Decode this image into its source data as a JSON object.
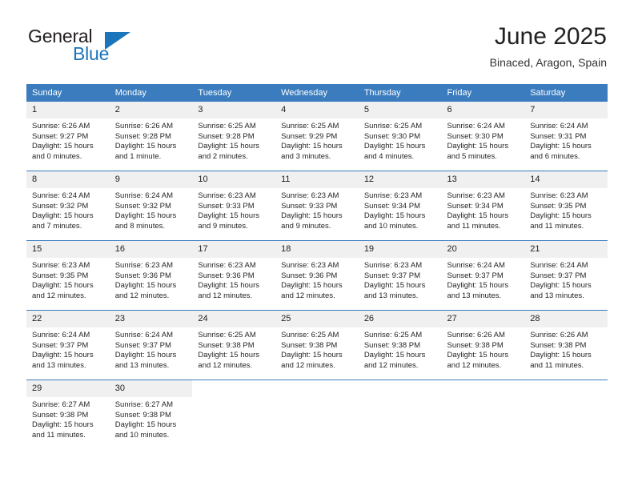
{
  "brand": {
    "name_top": "General",
    "name_bottom": "Blue",
    "triangle_color": "#1b75bb",
    "text_color": "#231f20"
  },
  "header": {
    "title": "June 2025",
    "subtitle": "Binaced, Aragon, Spain"
  },
  "theme": {
    "header_bar": "#3a7cbe",
    "daynum_bg": "#f0f0f0",
    "text": "#262626"
  },
  "weekday_headers": [
    "Sunday",
    "Monday",
    "Tuesday",
    "Wednesday",
    "Thursday",
    "Friday",
    "Saturday"
  ],
  "weeks": [
    [
      {
        "day": "1",
        "sunrise": "Sunrise: 6:26 AM",
        "sunset": "Sunset: 9:27 PM",
        "daylight_1": "Daylight: 15 hours",
        "daylight_2": "and 0 minutes."
      },
      {
        "day": "2",
        "sunrise": "Sunrise: 6:26 AM",
        "sunset": "Sunset: 9:28 PM",
        "daylight_1": "Daylight: 15 hours",
        "daylight_2": "and 1 minute."
      },
      {
        "day": "3",
        "sunrise": "Sunrise: 6:25 AM",
        "sunset": "Sunset: 9:28 PM",
        "daylight_1": "Daylight: 15 hours",
        "daylight_2": "and 2 minutes."
      },
      {
        "day": "4",
        "sunrise": "Sunrise: 6:25 AM",
        "sunset": "Sunset: 9:29 PM",
        "daylight_1": "Daylight: 15 hours",
        "daylight_2": "and 3 minutes."
      },
      {
        "day": "5",
        "sunrise": "Sunrise: 6:25 AM",
        "sunset": "Sunset: 9:30 PM",
        "daylight_1": "Daylight: 15 hours",
        "daylight_2": "and 4 minutes."
      },
      {
        "day": "6",
        "sunrise": "Sunrise: 6:24 AM",
        "sunset": "Sunset: 9:30 PM",
        "daylight_1": "Daylight: 15 hours",
        "daylight_2": "and 5 minutes."
      },
      {
        "day": "7",
        "sunrise": "Sunrise: 6:24 AM",
        "sunset": "Sunset: 9:31 PM",
        "daylight_1": "Daylight: 15 hours",
        "daylight_2": "and 6 minutes."
      }
    ],
    [
      {
        "day": "8",
        "sunrise": "Sunrise: 6:24 AM",
        "sunset": "Sunset: 9:32 PM",
        "daylight_1": "Daylight: 15 hours",
        "daylight_2": "and 7 minutes."
      },
      {
        "day": "9",
        "sunrise": "Sunrise: 6:24 AM",
        "sunset": "Sunset: 9:32 PM",
        "daylight_1": "Daylight: 15 hours",
        "daylight_2": "and 8 minutes."
      },
      {
        "day": "10",
        "sunrise": "Sunrise: 6:23 AM",
        "sunset": "Sunset: 9:33 PM",
        "daylight_1": "Daylight: 15 hours",
        "daylight_2": "and 9 minutes."
      },
      {
        "day": "11",
        "sunrise": "Sunrise: 6:23 AM",
        "sunset": "Sunset: 9:33 PM",
        "daylight_1": "Daylight: 15 hours",
        "daylight_2": "and 9 minutes."
      },
      {
        "day": "12",
        "sunrise": "Sunrise: 6:23 AM",
        "sunset": "Sunset: 9:34 PM",
        "daylight_1": "Daylight: 15 hours",
        "daylight_2": "and 10 minutes."
      },
      {
        "day": "13",
        "sunrise": "Sunrise: 6:23 AM",
        "sunset": "Sunset: 9:34 PM",
        "daylight_1": "Daylight: 15 hours",
        "daylight_2": "and 11 minutes."
      },
      {
        "day": "14",
        "sunrise": "Sunrise: 6:23 AM",
        "sunset": "Sunset: 9:35 PM",
        "daylight_1": "Daylight: 15 hours",
        "daylight_2": "and 11 minutes."
      }
    ],
    [
      {
        "day": "15",
        "sunrise": "Sunrise: 6:23 AM",
        "sunset": "Sunset: 9:35 PM",
        "daylight_1": "Daylight: 15 hours",
        "daylight_2": "and 12 minutes."
      },
      {
        "day": "16",
        "sunrise": "Sunrise: 6:23 AM",
        "sunset": "Sunset: 9:36 PM",
        "daylight_1": "Daylight: 15 hours",
        "daylight_2": "and 12 minutes."
      },
      {
        "day": "17",
        "sunrise": "Sunrise: 6:23 AM",
        "sunset": "Sunset: 9:36 PM",
        "daylight_1": "Daylight: 15 hours",
        "daylight_2": "and 12 minutes."
      },
      {
        "day": "18",
        "sunrise": "Sunrise: 6:23 AM",
        "sunset": "Sunset: 9:36 PM",
        "daylight_1": "Daylight: 15 hours",
        "daylight_2": "and 12 minutes."
      },
      {
        "day": "19",
        "sunrise": "Sunrise: 6:23 AM",
        "sunset": "Sunset: 9:37 PM",
        "daylight_1": "Daylight: 15 hours",
        "daylight_2": "and 13 minutes."
      },
      {
        "day": "20",
        "sunrise": "Sunrise: 6:24 AM",
        "sunset": "Sunset: 9:37 PM",
        "daylight_1": "Daylight: 15 hours",
        "daylight_2": "and 13 minutes."
      },
      {
        "day": "21",
        "sunrise": "Sunrise: 6:24 AM",
        "sunset": "Sunset: 9:37 PM",
        "daylight_1": "Daylight: 15 hours",
        "daylight_2": "and 13 minutes."
      }
    ],
    [
      {
        "day": "22",
        "sunrise": "Sunrise: 6:24 AM",
        "sunset": "Sunset: 9:37 PM",
        "daylight_1": "Daylight: 15 hours",
        "daylight_2": "and 13 minutes."
      },
      {
        "day": "23",
        "sunrise": "Sunrise: 6:24 AM",
        "sunset": "Sunset: 9:37 PM",
        "daylight_1": "Daylight: 15 hours",
        "daylight_2": "and 13 minutes."
      },
      {
        "day": "24",
        "sunrise": "Sunrise: 6:25 AM",
        "sunset": "Sunset: 9:38 PM",
        "daylight_1": "Daylight: 15 hours",
        "daylight_2": "and 12 minutes."
      },
      {
        "day": "25",
        "sunrise": "Sunrise: 6:25 AM",
        "sunset": "Sunset: 9:38 PM",
        "daylight_1": "Daylight: 15 hours",
        "daylight_2": "and 12 minutes."
      },
      {
        "day": "26",
        "sunrise": "Sunrise: 6:25 AM",
        "sunset": "Sunset: 9:38 PM",
        "daylight_1": "Daylight: 15 hours",
        "daylight_2": "and 12 minutes."
      },
      {
        "day": "27",
        "sunrise": "Sunrise: 6:26 AM",
        "sunset": "Sunset: 9:38 PM",
        "daylight_1": "Daylight: 15 hours",
        "daylight_2": "and 12 minutes."
      },
      {
        "day": "28",
        "sunrise": "Sunrise: 6:26 AM",
        "sunset": "Sunset: 9:38 PM",
        "daylight_1": "Daylight: 15 hours",
        "daylight_2": "and 11 minutes."
      }
    ],
    [
      {
        "day": "29",
        "sunrise": "Sunrise: 6:27 AM",
        "sunset": "Sunset: 9:38 PM",
        "daylight_1": "Daylight: 15 hours",
        "daylight_2": "and 11 minutes."
      },
      {
        "day": "30",
        "sunrise": "Sunrise: 6:27 AM",
        "sunset": "Sunset: 9:38 PM",
        "daylight_1": "Daylight: 15 hours",
        "daylight_2": "and 10 minutes."
      },
      {
        "day": "",
        "sunrise": "",
        "sunset": "",
        "daylight_1": "",
        "daylight_2": ""
      },
      {
        "day": "",
        "sunrise": "",
        "sunset": "",
        "daylight_1": "",
        "daylight_2": ""
      },
      {
        "day": "",
        "sunrise": "",
        "sunset": "",
        "daylight_1": "",
        "daylight_2": ""
      },
      {
        "day": "",
        "sunrise": "",
        "sunset": "",
        "daylight_1": "",
        "daylight_2": ""
      },
      {
        "day": "",
        "sunrise": "",
        "sunset": "",
        "daylight_1": "",
        "daylight_2": ""
      }
    ]
  ]
}
